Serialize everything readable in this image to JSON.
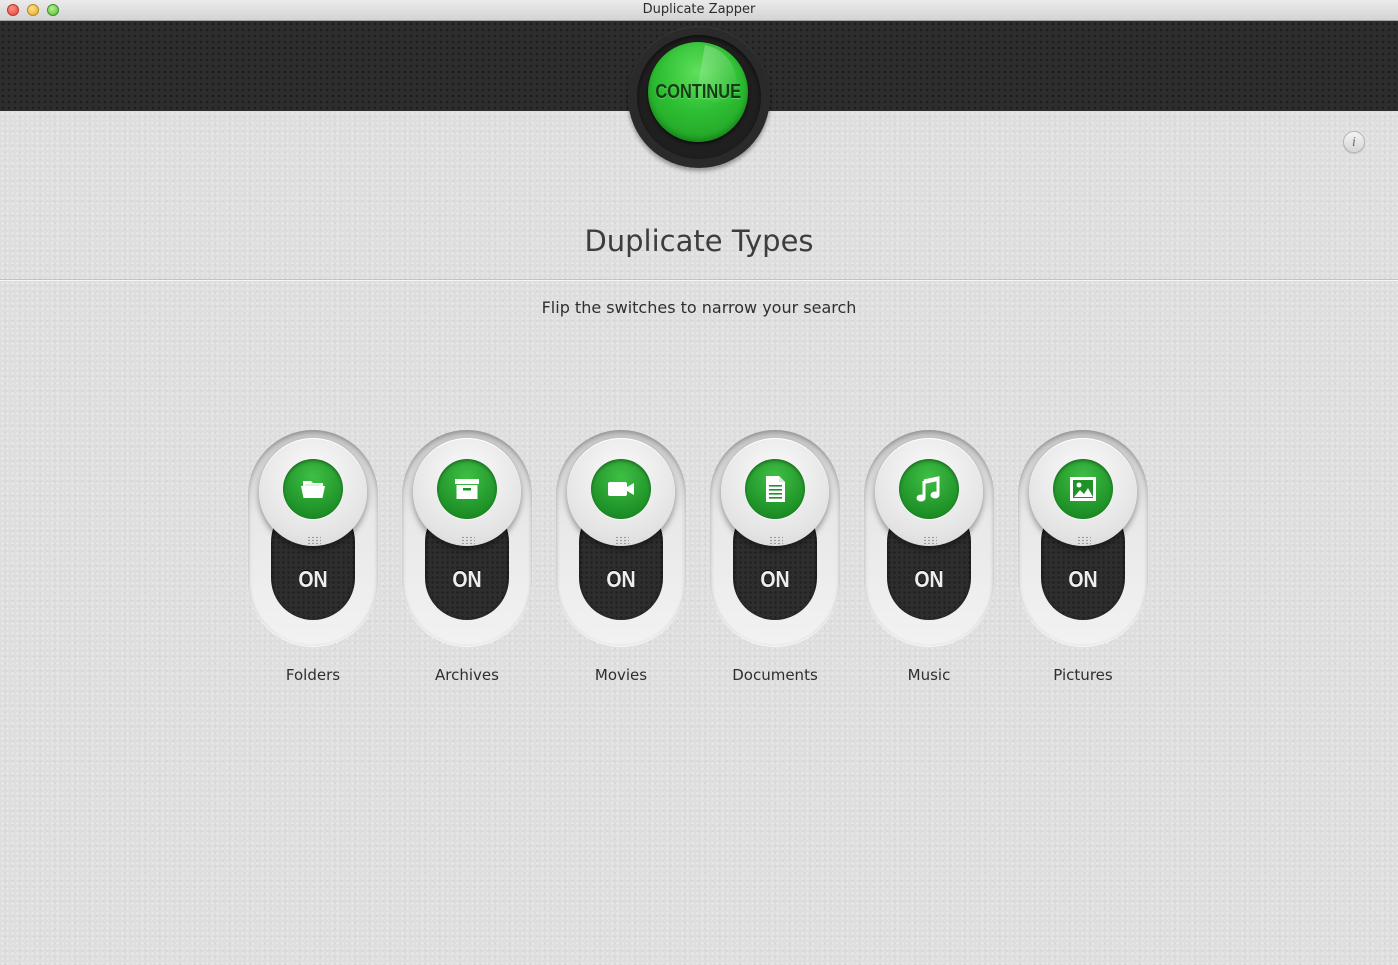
{
  "window": {
    "title": "Duplicate Zapper"
  },
  "header": {
    "continue_label": "CONTINUE"
  },
  "info_button": {
    "glyph": "i"
  },
  "main": {
    "title": "Duplicate Types",
    "subtitle": "Flip the switches to narrow your search"
  },
  "toggles": [
    {
      "label": "Folders",
      "state": "ON",
      "icon": "folder-icon"
    },
    {
      "label": "Archives",
      "state": "ON",
      "icon": "archive-icon"
    },
    {
      "label": "Movies",
      "state": "ON",
      "icon": "video-camera-icon"
    },
    {
      "label": "Documents",
      "state": "ON",
      "icon": "document-icon"
    },
    {
      "label": "Music",
      "state": "ON",
      "icon": "music-note-icon"
    },
    {
      "label": "Pictures",
      "state": "ON",
      "icon": "picture-icon"
    }
  ],
  "colors": {
    "accent_green": "#2fbf34",
    "header_dark": "#2d2d2d",
    "background": "#dedede"
  }
}
